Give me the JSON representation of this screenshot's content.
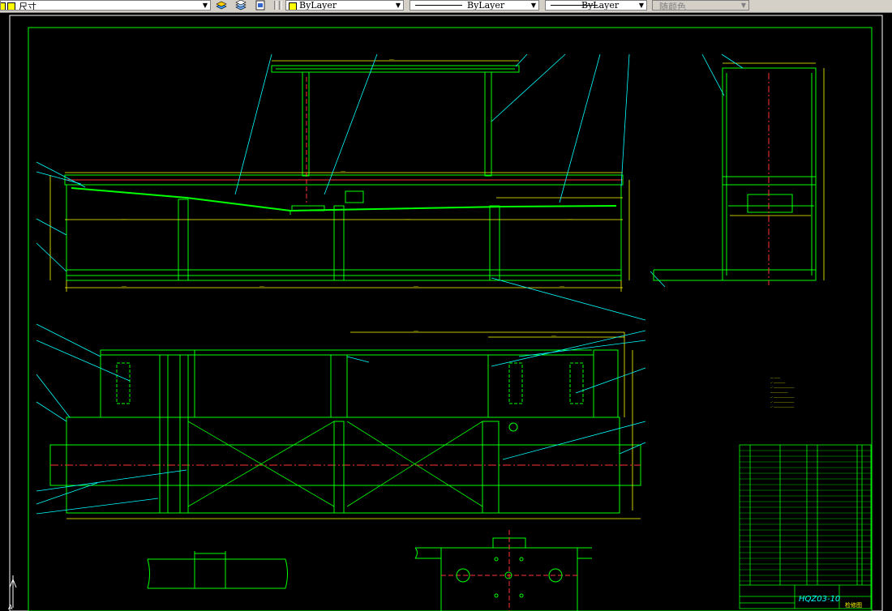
{
  "toolbar": {
    "dimstyle": {
      "value": "尺寸"
    },
    "layer_props": {
      "color": {
        "value": "ByLayer",
        "swatch": "#ffff00"
      },
      "linetype": {
        "value": "ByLayer"
      },
      "lineweight": {
        "value": "ByLayer"
      },
      "plotstyle": {
        "value": "随颜色"
      }
    },
    "icons": [
      "layers-icon",
      "layer-states-icon",
      "layer-previous-icon"
    ]
  },
  "drawing": {
    "title_block": {
      "drawing_number": "HQZ03-10",
      "part_name": "检修图"
    },
    "colors": {
      "geometry": "#00ff00",
      "frame": "#00ff00",
      "dimension": "#ffff00",
      "leader": "#00ffff",
      "centerline": "#ff0000",
      "text": "#ffffff",
      "background": "#000000"
    }
  }
}
